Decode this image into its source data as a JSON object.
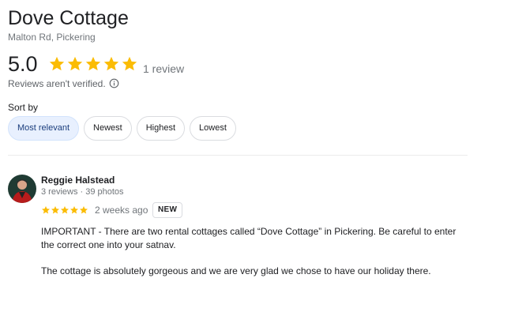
{
  "place": {
    "title": "Dove Cottage",
    "address": "Malton Rd, Pickering"
  },
  "rating": {
    "value": "5.0",
    "stars": 5,
    "review_count_label": "1 review",
    "unverified_label": "Reviews aren't verified.",
    "star_color": "#fbbc04"
  },
  "sort": {
    "label": "Sort by",
    "options": [
      "Most relevant",
      "Newest",
      "Highest",
      "Lowest"
    ],
    "selected": "Most relevant"
  },
  "review": {
    "author": "Reggie Halstead",
    "meta": "3 reviews · 39 photos",
    "stars": 5,
    "time": "2 weeks ago",
    "badge": "NEW",
    "paragraphs": [
      "IMPORTANT - There are two rental cottages called “Dove Cottage” in Pickering. Be careful to enter the correct one into your satnav.",
      "The cottage is absolutely gorgeous and we are very glad we chose to have our holiday there."
    ]
  },
  "icons": {
    "star": "star-icon",
    "info": "info-icon",
    "avatar": "reviewer-avatar"
  }
}
